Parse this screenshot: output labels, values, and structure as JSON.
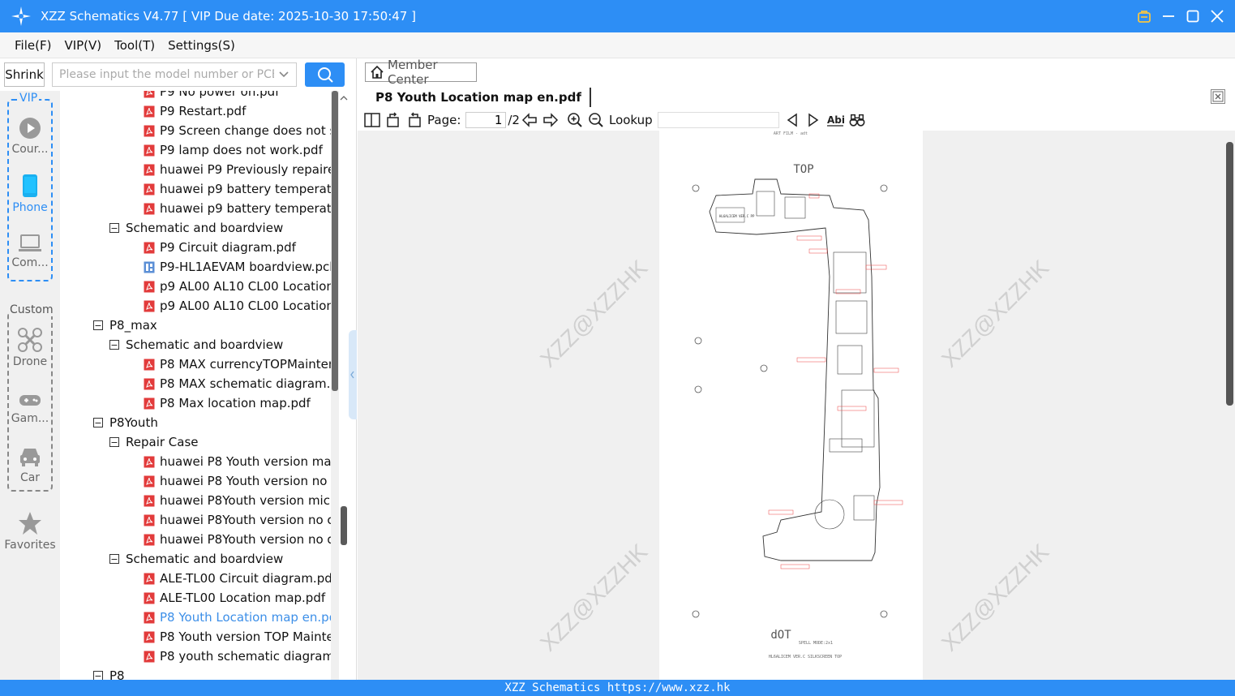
{
  "window": {
    "title": "XZZ Schematics V4.77 [ VIP Due date: 2025-10-30 17:50:47 ]",
    "accent": "#2d8ef5"
  },
  "menu": [
    "File(F)",
    "VIP(V)",
    "Tool(T)",
    "Settings(S)"
  ],
  "left": {
    "shrink_label": "Shrink",
    "search_placeholder": "Please input the model number or PCB"
  },
  "rail": {
    "vip_label": "VIP",
    "custom_label": "Custom",
    "items": [
      {
        "label": "Cour...",
        "icon": "play-icon"
      },
      {
        "label": "Phone",
        "icon": "phone-icon"
      },
      {
        "label": "Com...",
        "icon": "laptop-icon"
      },
      {
        "label": "Drone",
        "icon": "drone-icon"
      },
      {
        "label": "Gam...",
        "icon": "gamepad-icon"
      },
      {
        "label": "Car",
        "icon": "car-icon"
      },
      {
        "label": "Favorites",
        "icon": "star-icon"
      }
    ]
  },
  "tree": [
    {
      "label": "P9 No power on.pdf",
      "type": "pdf",
      "level": 3
    },
    {
      "label": "P9 Restart.pdf",
      "type": "pdf",
      "level": 3
    },
    {
      "label": "P9 Screen change does not star",
      "type": "pdf",
      "level": 3
    },
    {
      "label": "P9 lamp does not work.pdf",
      "type": "pdf",
      "level": 3
    },
    {
      "label": "huawei P9 Previously repaired I",
      "type": "pdf",
      "level": 3
    },
    {
      "label": "huawei p9 battery temperature",
      "type": "pdf",
      "level": 3
    },
    {
      "label": "huawei p9 battery temperature",
      "type": "pdf",
      "level": 3
    },
    {
      "label": "Schematic and boardview",
      "type": "folder",
      "level": 2
    },
    {
      "label": "P9 Circuit diagram.pdf",
      "type": "pdf",
      "level": 3
    },
    {
      "label": "P9-HL1AEVAM boardview.pcb",
      "type": "pcb",
      "level": 3
    },
    {
      "label": "p9 AL00 AL10 CL00 Location ma",
      "type": "pdf",
      "level": 3
    },
    {
      "label": "p9 AL00 AL10 CL00 Location ma",
      "type": "pdf",
      "level": 3
    },
    {
      "label": "P8_max",
      "type": "folder",
      "level": 1
    },
    {
      "label": "Schematic and boardview",
      "type": "folder",
      "level": 2
    },
    {
      "label": "P8 MAX currencyTOPMaintenar",
      "type": "pdf",
      "level": 3
    },
    {
      "label": "P8 MAX schematic diagram.pdf",
      "type": "pdf",
      "level": 3
    },
    {
      "label": "P8 Max location map.pdf",
      "type": "pdf",
      "level": 3
    },
    {
      "label": "P8Youth",
      "type": "folder",
      "level": 1
    },
    {
      "label": "Repair Case",
      "type": "folder",
      "level": 2
    },
    {
      "label": "huawei P8 Youth version  main",
      "type": "pdf",
      "level": 3
    },
    {
      "label": "huawei P8 Youth version  no pc",
      "type": "pdf",
      "level": 3
    },
    {
      "label": "huawei P8Youth version  microp",
      "type": "pdf",
      "level": 3
    },
    {
      "label": "huawei P8Youth version  no cha",
      "type": "pdf",
      "level": 3
    },
    {
      "label": "huawei P8Youth version  no dis",
      "type": "pdf",
      "level": 3
    },
    {
      "label": "Schematic and boardview",
      "type": "folder",
      "level": 2
    },
    {
      "label": "ALE-TL00 Circuit diagram.pdf",
      "type": "pdf",
      "level": 3
    },
    {
      "label": "ALE-TL00 Location map.pdf",
      "type": "pdf",
      "level": 3
    },
    {
      "label": "P8 Youth Location map en.pdf",
      "type": "pdf",
      "level": 3,
      "selected": true
    },
    {
      "label": "P8 Youth version TOP Maintena",
      "type": "pdf",
      "level": 3
    },
    {
      "label": "P8 youth schematic diagram.pd",
      "type": "pdf",
      "level": 3
    },
    {
      "label": "P8",
      "type": "folder",
      "level": 1
    }
  ],
  "right": {
    "member_center": "Member Center",
    "doc_tab": "P8 Youth Location map en.pdf",
    "page_label": "Page:",
    "page_value": "1",
    "page_total": "/2",
    "lookup_label": "Lookup",
    "watermark": "XZZ@XZZHK"
  },
  "pdf_page": {
    "header": "ART FILM - adt",
    "top_label": "TOP",
    "bottom_label": "dOT",
    "caption1": "SPELL MODE:2x1",
    "caption2": "HL6ALICEM VER.C SILKSCREEN TOP",
    "board_tag": "HL6ALICEM VER.C PP"
  },
  "status": {
    "text": "XZZ Schematics https://www.xzz.hk"
  }
}
